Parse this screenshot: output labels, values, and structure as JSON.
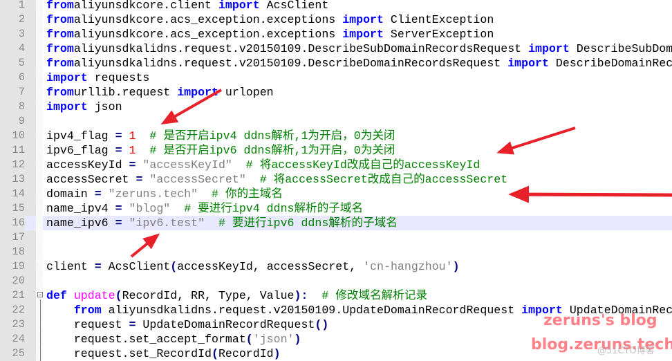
{
  "editor": {
    "current_line": 16,
    "lines": [
      {
        "n": "1",
        "tokens": [
          [
            "kw",
            "from"
          ],
          [
            "",
            "aliyunsdkcore.client "
          ],
          [
            "kw",
            "import"
          ],
          [
            "",
            " AcsClient"
          ]
        ]
      },
      {
        "n": "2",
        "tokens": [
          [
            "kw",
            "from"
          ],
          [
            "",
            "aliyunsdkcore.acs_exception.exceptions "
          ],
          [
            "kw",
            "import"
          ],
          [
            "",
            " ClientException"
          ]
        ]
      },
      {
        "n": "3",
        "tokens": [
          [
            "kw",
            "from"
          ],
          [
            "",
            "aliyunsdkcore.acs_exception.exceptions "
          ],
          [
            "kw",
            "import"
          ],
          [
            "",
            " ServerException"
          ]
        ]
      },
      {
        "n": "4",
        "tokens": [
          [
            "kw",
            "from"
          ],
          [
            "",
            "aliyunsdkalidns.request.v20150109.DescribeSubDomainRecordsRequest "
          ],
          [
            "kw",
            "import"
          ],
          [
            "",
            " DescribeSubDomainRecordsRequest"
          ]
        ]
      },
      {
        "n": "5",
        "tokens": [
          [
            "kw",
            "from"
          ],
          [
            "",
            "aliyunsdkalidns.request.v20150109.DescribeDomainRecordsRequest "
          ],
          [
            "kw",
            "import"
          ],
          [
            "",
            " DescribeDomainRecordsRequest"
          ]
        ]
      },
      {
        "n": "6",
        "tokens": [
          [
            "kw",
            "import"
          ],
          [
            "",
            " requests"
          ]
        ]
      },
      {
        "n": "7",
        "tokens": [
          [
            "kw",
            "from"
          ],
          [
            "",
            "urllib.request "
          ],
          [
            "kw",
            "import"
          ],
          [
            "",
            " urlopen"
          ]
        ]
      },
      {
        "n": "8",
        "tokens": [
          [
            "kw",
            "import"
          ],
          [
            "",
            " json"
          ]
        ]
      },
      {
        "n": "9",
        "tokens": []
      },
      {
        "n": "10",
        "tokens": [
          [
            "",
            "ipv4_flag "
          ],
          [
            "op",
            "="
          ],
          [
            " ",
            ""
          ],
          [
            "num",
            " 1"
          ],
          [
            "cmt",
            "  # 是否开启ipv4 ddns解析,1为开启，0为关闭"
          ]
        ]
      },
      {
        "n": "11",
        "tokens": [
          [
            "",
            "ipv6_flag "
          ],
          [
            "op",
            "="
          ],
          [
            "num",
            " 1"
          ],
          [
            "cmt",
            "  # 是否开启ipv6 ddns解析,1为开启，0为关闭"
          ]
        ]
      },
      {
        "n": "12",
        "tokens": [
          [
            "",
            "accessKeyId "
          ],
          [
            "op",
            "="
          ],
          [
            "str",
            " \"accessKeyId\""
          ],
          [
            "cmt",
            "  # 将accessKeyId改成自己的accessKeyId"
          ]
        ]
      },
      {
        "n": "13",
        "tokens": [
          [
            "",
            "accessSecret "
          ],
          [
            "op",
            "="
          ],
          [
            "str",
            " \"accessSecret\""
          ],
          [
            "cmt",
            "  # 将accessSecret改成自己的accessSecret"
          ]
        ]
      },
      {
        "n": "14",
        "tokens": [
          [
            "",
            "domain "
          ],
          [
            "op",
            "="
          ],
          [
            "str",
            " \"zeruns.tech\""
          ],
          [
            "cmt",
            "  # 你的主域名"
          ]
        ]
      },
      {
        "n": "15",
        "tokens": [
          [
            "",
            "name_ipv4 "
          ],
          [
            "op",
            "="
          ],
          [
            "str",
            " \"blog\""
          ],
          [
            "cmt",
            "  # 要进行ipv4 ddns解析的子域名"
          ]
        ]
      },
      {
        "n": "16",
        "tokens": [
          [
            "",
            "name_ipv6 "
          ],
          [
            "op",
            "="
          ],
          [
            "str",
            " \"ipv6.test\""
          ],
          [
            "cmt",
            "  # 要进行ipv6 ddns解析的子域名"
          ]
        ]
      },
      {
        "n": "17",
        "tokens": []
      },
      {
        "n": "18",
        "tokens": []
      },
      {
        "n": "19",
        "tokens": [
          [
            "",
            "client "
          ],
          [
            "op",
            "="
          ],
          [
            "",
            " AcsClient"
          ],
          [
            "paren",
            "("
          ],
          [
            "",
            "accessKeyId, accessSecret, "
          ],
          [
            "str",
            "'cn-hangzhou'"
          ],
          [
            "paren",
            ")"
          ]
        ]
      },
      {
        "n": "20",
        "tokens": []
      },
      {
        "n": "21",
        "tokens": [
          [
            "kw",
            "def"
          ],
          [
            "",
            " "
          ],
          [
            "fn",
            "update"
          ],
          [
            "paren",
            "("
          ],
          [
            "",
            "RecordId, RR, Type, Value"
          ],
          [
            "paren",
            ")"
          ],
          [
            "op",
            ":"
          ],
          [
            "cmt",
            "  # 修改域名解析记录"
          ]
        ]
      },
      {
        "n": "22",
        "tokens": [
          [
            "",
            "    "
          ],
          [
            "kw",
            "from"
          ],
          [
            "",
            " aliyunsdkalidns.request.v20150109.UpdateDomainRecordRequest "
          ],
          [
            "kw",
            "import"
          ],
          [
            "",
            " UpdateDomainRecordRequest"
          ]
        ]
      },
      {
        "n": "23",
        "tokens": [
          [
            "",
            "    request "
          ],
          [
            "op",
            "="
          ],
          [
            "",
            " UpdateDomainRecordRequest"
          ],
          [
            "paren",
            "()"
          ]
        ]
      },
      {
        "n": "24",
        "tokens": [
          [
            "",
            "    request.set_accept_format"
          ],
          [
            "paren",
            "("
          ],
          [
            "str",
            "'json'"
          ],
          [
            "paren",
            ")"
          ]
        ]
      },
      {
        "n": "25",
        "tokens": [
          [
            "",
            "    request.set_RecordId"
          ],
          [
            "paren",
            "("
          ],
          [
            "",
            "RecordId"
          ],
          [
            "paren",
            ")"
          ]
        ]
      }
    ]
  },
  "watermark": {
    "title": "zeruns's blog",
    "url": "blog.zeruns.tech",
    "platform": "@51CTO博客"
  },
  "annotation_color": "#e8202a"
}
